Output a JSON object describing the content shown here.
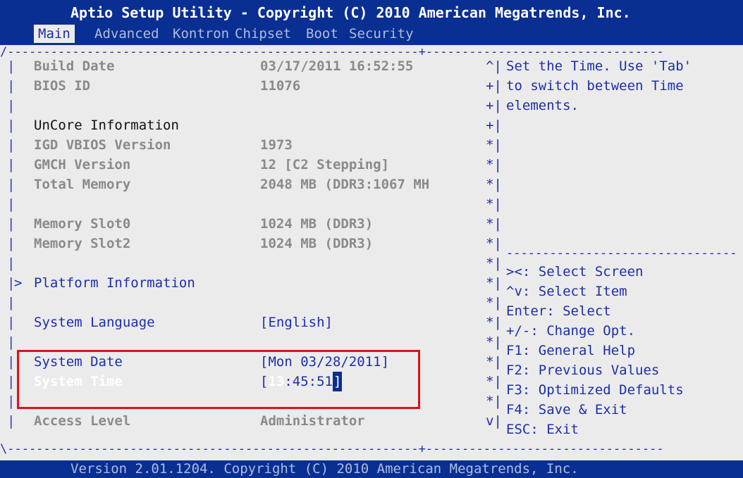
{
  "header": {
    "title": "Aptio Setup Utility - Copyright (C) 2010 American Megatrends, Inc.",
    "tabs": [
      {
        "label": "Main",
        "active": true
      },
      {
        "label": "Advanced"
      },
      {
        "label": "Kontron"
      },
      {
        "label": "Chipset"
      },
      {
        "label": "Boot"
      },
      {
        "label": "Security"
      }
    ]
  },
  "main": {
    "build_date_label": "Build Date",
    "build_date_value": "03/17/2011 16:52:55",
    "bios_id_label": "BIOS ID",
    "bios_id_value": "11076",
    "uncore_heading": "UnCore Information",
    "igd_label": "IGD VBIOS Version",
    "igd_value": "1973",
    "gmch_label": "GMCH Version",
    "gmch_value": "12 [C2 Stepping]",
    "total_mem_label": "Total Memory",
    "total_mem_value": "2048 MB (DDR3:1067 MH",
    "slot0_label": "Memory Slot0",
    "slot0_value": "1024 MB (DDR3)",
    "slot2_label": "Memory Slot2",
    "slot2_value": "1024 MB (DDR3)",
    "platform_arrow": ">",
    "platform_label": "Platform Information",
    "language_label": "System Language",
    "language_value": "[English]",
    "date_label": "System Date",
    "date_value": "[Mon 03/28/2011]",
    "time_label": "System Time",
    "time_open": "[",
    "time_hour": "13",
    "time_rest": ":45:51",
    "time_close": "]",
    "access_label": "Access Level",
    "access_value": "Administrator"
  },
  "help": {
    "lines": [
      "Set the Time. Use 'Tab'",
      "to switch between Time",
      "elements."
    ]
  },
  "keys": [
    "><: Select Screen",
    "^v: Select Item",
    "Enter: Select",
    "+/-: Change Opt.",
    "F1: General Help",
    "F2: Previous Values",
    "F3: Optimized Defaults",
    "F4: Save & Exit",
    "ESC: Exit"
  ],
  "scroll_markers": [
    "^",
    "+",
    "+",
    "+",
    "*",
    "*",
    "*",
    "*",
    "*",
    "*",
    "*",
    "*",
    "*",
    "*",
    "*",
    "*",
    "*",
    "*",
    "v"
  ],
  "footer": {
    "version": "Version 2.01.1204. Copyright (C) 2010 American Megatrends, Inc."
  },
  "colors": {
    "header_bg": "#0a2f93",
    "body_bg": "#ebebeb",
    "text_blue": "#1c2fa8",
    "highlight_red": "#e0101a"
  }
}
